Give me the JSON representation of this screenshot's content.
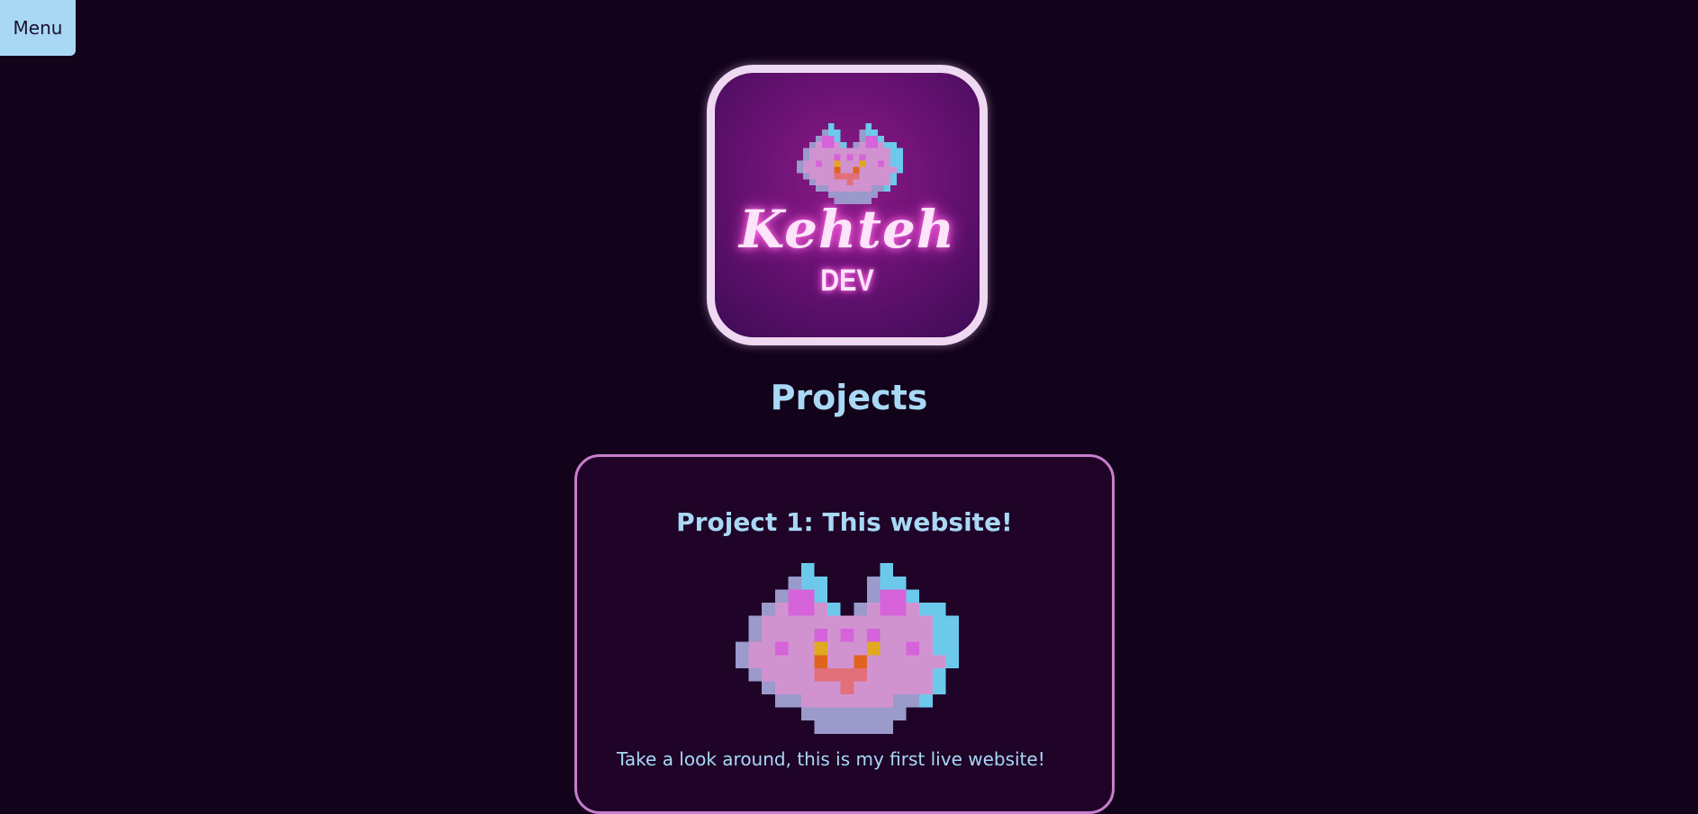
{
  "menu": {
    "label": "Menu"
  },
  "logo": {
    "script_text": "Kehteh",
    "sub_text": "DEV"
  },
  "page": {
    "title": "Projects"
  },
  "projects": [
    {
      "title": "Project 1: This website!",
      "description": "Take a look around, this is my first live website!"
    }
  ],
  "colors": {
    "background": "#12031a",
    "accent": "#a9d8f5",
    "card_border": "#c77dce",
    "card_background": "#1f0428"
  },
  "icons": {
    "logo_cat": "pixel-cat-heart-icon",
    "project_cat": "pixel-cat-heart-icon"
  }
}
